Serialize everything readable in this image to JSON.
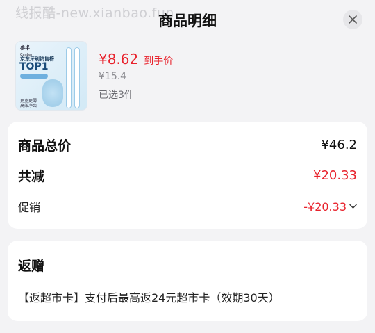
{
  "watermark": "线报酷-new.xianbao.fun",
  "header": {
    "title": "商品明细"
  },
  "product": {
    "thumb_text": {
      "brand": "参半",
      "brand_sub": "Canban",
      "rank_line": "京东牙刷销售榜",
      "rank": "TOP1",
      "feature_1": "更宽更薄",
      "feature_2": "高效净齿"
    },
    "price": "¥8.62",
    "price_tag": "到手价",
    "original_price": "¥15.4",
    "selected_count": "已选3件"
  },
  "summary": {
    "total_label": "商品总价",
    "total_value": "¥46.2",
    "discount_label": "共减",
    "discount_value": "¥20.33",
    "promo_label": "促销",
    "promo_value": "-¥20.33"
  },
  "gift": {
    "title": "返赠",
    "description": "【返超市卡】支付后最高返24元超市卡（效期30天）"
  },
  "colors": {
    "accent_red": "#e8222c",
    "background": "#f3f3f5"
  }
}
